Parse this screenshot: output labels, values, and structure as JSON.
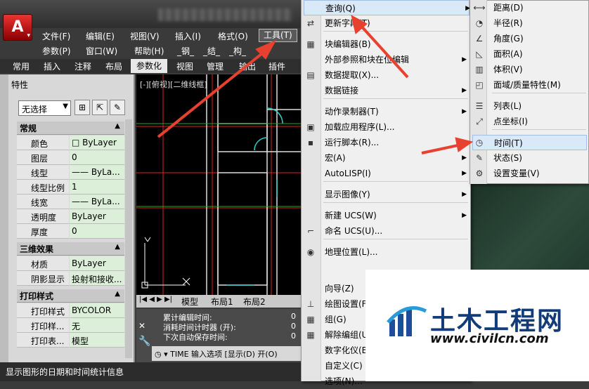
{
  "menubar": {
    "row1": [
      "文件(F)",
      "编辑(E)",
      "视图(V)",
      "插入(I)",
      "格式(O)",
      "工具(T)"
    ],
    "row2": [
      "参数(P)",
      "窗口(W)",
      "帮助(H)",
      "_钢_",
      "_结_",
      "_构_"
    ]
  },
  "ribbon_tabs": [
    "常用",
    "插入",
    "注释",
    "布局",
    "参数化",
    "视图",
    "管理",
    "输出",
    "插件"
  ],
  "palette": {
    "title": "特性",
    "selection": "无选择",
    "sections": {
      "general": "常规",
      "3d": "三维效果",
      "plot": "打印样式"
    },
    "general_rows": [
      {
        "k": "颜色",
        "v": "□ ByLayer"
      },
      {
        "k": "图层",
        "v": "0"
      },
      {
        "k": "线型",
        "v": "—— ByLa..."
      },
      {
        "k": "线型比例",
        "v": "1"
      },
      {
        "k": "线宽",
        "v": "—— ByLa..."
      },
      {
        "k": "透明度",
        "v": "ByLayer"
      },
      {
        "k": "厚度",
        "v": "0"
      }
    ],
    "3d_rows": [
      {
        "k": "材质",
        "v": "ByLayer"
      },
      {
        "k": "阴影显示",
        "v": "投射和接收..."
      }
    ],
    "plot_rows": [
      {
        "k": "打印样式",
        "v": "BYCOLOR"
      },
      {
        "k": "打印样...",
        "v": "无"
      },
      {
        "k": "打印表...",
        "v": "模型"
      }
    ]
  },
  "viewport_label": "[-][俯视][二维线框]",
  "layout_tabs": [
    "模型",
    "布局1",
    "布局2"
  ],
  "command": {
    "lines": [
      {
        "label": "累计编辑时间:",
        "value": "0"
      },
      {
        "label": "消耗时间计时器 (开):",
        "value": "0"
      },
      {
        "label": "下次自动保存时间:",
        "value": "0"
      }
    ],
    "prompt": "TIME 输入选项 [显示(D) 开(O)"
  },
  "status_text": "显示图形的日期和时间统计信息",
  "tools_menu": [
    {
      "label": "查询(Q)",
      "sub": true,
      "hl": true
    },
    {
      "label": "更新字段(T)",
      "sub": false
    },
    {
      "label": "块编辑器(B)",
      "sub": false
    },
    {
      "label": "外部参照和块在位编辑",
      "sub": true
    },
    {
      "label": "数据提取(X)...",
      "sub": false
    },
    {
      "label": "数据链接",
      "sub": true
    },
    {
      "label": "动作录制器(T)",
      "sub": true
    },
    {
      "label": "加载应用程序(L)...",
      "sub": false
    },
    {
      "label": "运行脚本(R)...",
      "sub": false
    },
    {
      "label": "宏(A)",
      "sub": true
    },
    {
      "label": "AutoLISP(I)",
      "sub": true
    },
    {
      "label": "显示图像(Y)",
      "sub": true
    },
    {
      "label": "新建 UCS(W)",
      "sub": true
    },
    {
      "label": "命名 UCS(U)...",
      "sub": false
    },
    {
      "label": "地理位置(L)...",
      "sub": false
    },
    {
      "label": "向导(Z)",
      "sub": false
    },
    {
      "label": "绘图设置(F)",
      "sub": false
    },
    {
      "label": "组(G)",
      "sub": false
    },
    {
      "label": "解除编组(U)",
      "sub": false
    },
    {
      "label": "数字化仪(B)",
      "sub": false
    },
    {
      "label": "自定义(C)",
      "sub": false
    },
    {
      "label": "选项(N)...",
      "sub": false
    }
  ],
  "query_menu": [
    {
      "label": "距离(D)"
    },
    {
      "label": "半径(R)"
    },
    {
      "label": "角度(G)"
    },
    {
      "label": "面积(A)"
    },
    {
      "label": "体积(V)"
    },
    {
      "label": "面域/质量特性(M)"
    },
    {
      "label": "列表(L)"
    },
    {
      "label": "点坐标(I)"
    },
    {
      "label": "时间(T)",
      "hl": true
    },
    {
      "label": "状态(S)"
    },
    {
      "label": "设置变量(V)"
    }
  ],
  "watermark": {
    "title": "土木工程网",
    "url": "www.civilcn.com"
  },
  "colors": {
    "arrow": "#e8412f",
    "highlight": "#dbe8f8",
    "property_value_bg": "#dcefd9"
  }
}
